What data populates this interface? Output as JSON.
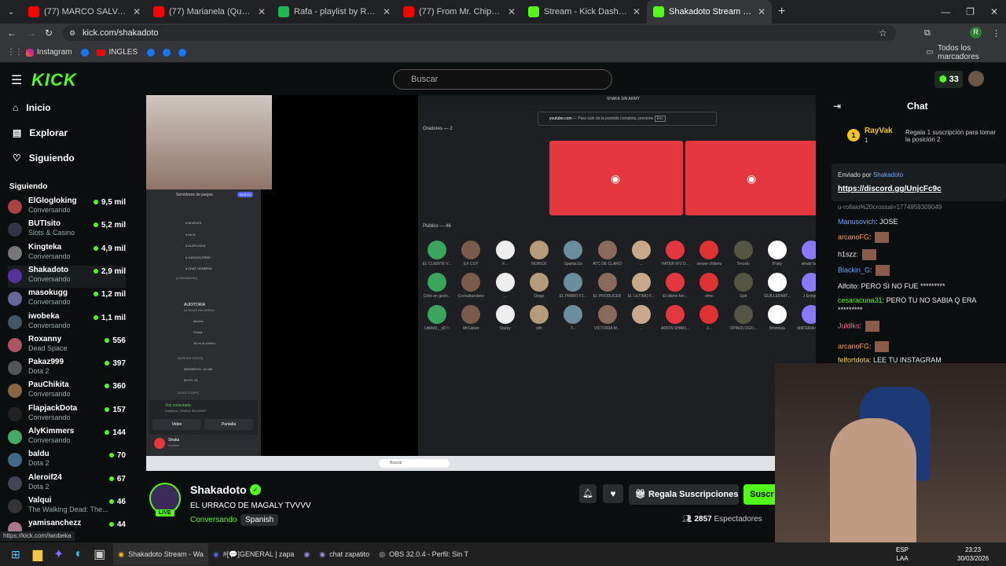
{
  "tabs": [
    {
      "title": "(77) MARCO SALVA A GRACE D",
      "color": "#ff0000"
    },
    {
      "title": "(77) Marianela (Que Pasa) (Exte",
      "color": "#ff0000"
    },
    {
      "title": "Rafa - playlist by RafaeIxared |",
      "color": "#1db954"
    },
    {
      "title": "(77) From Mr. Chips to Scarface",
      "color": "#ff0000"
    },
    {
      "title": "Stream - Kick Dashboard",
      "color": "#53fc18"
    },
    {
      "title": "Shakadoto Stream - Watch",
      "color": "#53fc18"
    }
  ],
  "address": "kick.com/shakadoto",
  "bookmarks": [
    "Instagram",
    "INGLES",
    "Todos los marcadores"
  ],
  "header": {
    "logo": "KICK",
    "search_placeholder": "Buscar",
    "points": "33"
  },
  "nav": [
    "Inicio",
    "Explorar",
    "Siguiendo"
  ],
  "following_title": "Siguiendo",
  "following": [
    {
      "name": "ElGlogloking",
      "cat": "Conversando",
      "viewers": "9,5 mil",
      "color": "#a44"
    },
    {
      "name": "BUTIsito",
      "cat": "Slots & Casino",
      "viewers": "5,2 mil",
      "color": "#334"
    },
    {
      "name": "Kingteka",
      "cat": "Conversando",
      "viewers": "4,9 mil",
      "color": "#777"
    },
    {
      "name": "Shakadoto",
      "cat": "Conversando",
      "viewers": "2,9 mil",
      "color": "#539"
    },
    {
      "name": "masokugg",
      "cat": "Conversando",
      "viewers": "1,2 mil",
      "color": "#669"
    },
    {
      "name": "iwobeka",
      "cat": "Conversando",
      "viewers": "1,1 mil",
      "color": "#456"
    },
    {
      "name": "Roxanny",
      "cat": "Dead Space",
      "viewers": "556",
      "color": "#a56"
    },
    {
      "name": "Pakaz999",
      "cat": "Dota 2",
      "viewers": "397",
      "color": "#555"
    },
    {
      "name": "PauChikita",
      "cat": "Conversando",
      "viewers": "360",
      "color": "#864"
    },
    {
      "name": "FlapjackDota",
      "cat": "Conversando",
      "viewers": "157",
      "color": "#222"
    },
    {
      "name": "AlyKimmers",
      "cat": "Conversando",
      "viewers": "144",
      "color": "#4a6"
    },
    {
      "name": "baldu",
      "cat": "Dota 2",
      "viewers": "70",
      "color": "#468"
    },
    {
      "name": "Aleroif24",
      "cat": "Dota 2",
      "viewers": "67",
      "color": "#445"
    },
    {
      "name": "Valqui",
      "cat": "The Walking Dead: The...",
      "viewers": "46",
      "color": "#333"
    },
    {
      "name": "yamisanchezz",
      "cat": "",
      "viewers": "44",
      "color": "#a78"
    }
  ],
  "status_url": "https://kick.com/iwobeka",
  "video": {
    "window_title": "SHAKA SIN ARMY",
    "hint": "Para salir de la pantalla completa, presione",
    "hint_site": "youtube.com",
    "hint_key": "Esc",
    "speakers": "Oradores — 2",
    "audience": "Público — 46",
    "audience_names": [
      "EL CLIENTE V...",
      "EX CUY",
      "F...",
      "NORICK",
      "SpartacUs",
      "ATC DE CLARO",
      "...",
      "HATER Nº1 D...",
      "viewer chileno",
      "Trecelo",
      "IFaky",
      "whale baby",
      "Santito",
      "Tyler",
      "",
      "Adriano",
      "Cirilo en gesh...",
      "Cochabambino",
      "...",
      "Diego",
      "EL PRIMO F1...",
      "EL PRODUCER",
      "EL ULTIMO F...",
      "El último fan...",
      "elmo",
      "Gpk",
      "GUILLERMIT...",
      "J Enrique",
      "Jared Avila",
      "J...",
      "K8",
      "Limón",
      "LitMaN__xD !!",
      "MrCabén",
      "Starky",
      "stfn",
      "T...",
      "VICTORIA M...",
      "...",
      "ADIOS SHAKI...",
      "J...",
      "OPINOLOGO...",
      "Bromista",
      "MATERIA GRI...",
      "FUMON_NAR...",
      "Qwqrr"
    ],
    "server_name": "Servidores de juegos",
    "new_badge": "NUEVO",
    "channels": [
      "# NIVELES",
      "# KICK",
      "# CLIPS-KICK",
      "# JUEGOS-FREE",
      "# CHAT GENERAL"
    ],
    "categories": [
      "[COMUNIDAD]",
      "[SERVER STATS]",
      "[SOLO STAFF]"
    ],
    "stage": "AUDITORIA",
    "stage_sub": "ULTIMAS PALABRAS",
    "stage_users": [
      "danielo",
      "Shaka",
      "46 en el público"
    ],
    "stats": [
      "MIEMBROS: 19.036",
      "BOTS: 25"
    ],
    "voice": {
      "status": "Voz conectada",
      "sub": "Auditoria / SHAKA SIN ARMY",
      "video": "Video",
      "screen": "Pantalla"
    },
    "user": {
      "name": "Shaka",
      "status": "Invisible"
    },
    "taskbar_search": "Buscar"
  },
  "chat": {
    "title": "Chat",
    "top_user": "RayVak",
    "top_rank": "1",
    "top_count": "1",
    "gift_promo": "Regala 1 suscripción para tomar la posición 2",
    "pinned_by_label": "Enviado por",
    "pinned_author": "Shakadoto",
    "pinned_link": "https://discord.gg/UnjcFc9c",
    "partial": "u-rollaio%20crossal=1774959309049",
    "messages": [
      {
        "user": "Manusovich",
        "text": "JOSE",
        "color": "#6fa8ff"
      },
      {
        "user": "arcanoFG",
        "text": "",
        "color": "#ff9f43"
      },
      {
        "user": "h1szz",
        "text": "",
        "color": "#eee"
      },
      {
        "user": "Blackin_G",
        "text": "",
        "color": "#6fa8ff"
      },
      {
        "user": "Alfcito",
        "text": "PERO SI NO FUE *********",
        "color": "#eee"
      },
      {
        "user": "cesaracuna31",
        "text": "PERO TU NO SABIA Q ERA *********",
        "color": "#53fc18"
      },
      {
        "user": "Juldlks",
        "text": "",
        "color": "#ff5f8f"
      },
      {
        "user": "arcanoFG",
        "text": "",
        "color": "#ff9f43"
      },
      {
        "user": "felfortdota",
        "text": "LEE TU INSTAGRAM",
        "color": "#ffd43b"
      }
    ]
  },
  "channel": {
    "name": "Shakadoto",
    "title": "EL URRACO DE MAGALY TVVVV",
    "category": "Conversando",
    "language": "Spanish",
    "live": "LIVE",
    "gift_button": "Regala Suscripciones",
    "sub_button": "Suscr",
    "viewers": "2857",
    "viewers_label": "Espectadores"
  },
  "taskbar": {
    "items": [
      "Shakadoto Stream - Wa",
      "#[💬]GENERAL | zapa",
      "chat zapatito",
      "OBS 32.0.4 - Perfil: Sin T"
    ],
    "lang": "ESP",
    "lang2": "LAA",
    "time": "23:23",
    "date": "30/03/2026"
  }
}
